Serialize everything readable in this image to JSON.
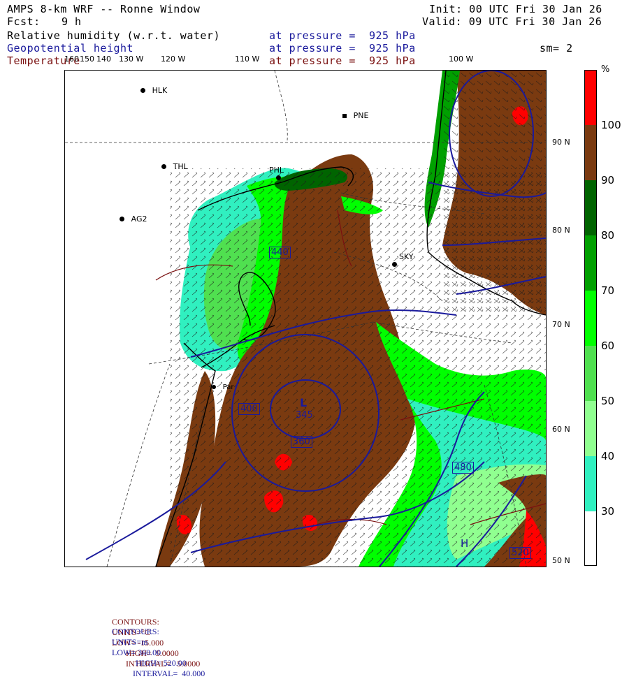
{
  "header": {
    "title": "AMPS 8-km WRF -- Ronne Window",
    "forecast_label": "Fcst:",
    "forecast_value": "9 h",
    "init": "Init: 00 UTC Fri 30 Jan 26",
    "valid": "Valid: 09 UTC Fri 30 Jan 26",
    "fields": [
      {
        "name": "Relative humidity (w.r.t. water)",
        "level": "at pressure =  925 hPa",
        "color": "#000000"
      },
      {
        "name": "Geopotential height",
        "level": "at pressure =  925 hPa",
        "color": "#1a1a9c"
      },
      {
        "name": "Temperature",
        "level": "at pressure =  925 hPa",
        "color": "#7a1010"
      }
    ],
    "smoothing": "sm= 2"
  },
  "colorbar": {
    "unit": "%",
    "levels": [
      "100",
      "90",
      "80",
      "70",
      "60",
      "50",
      "40",
      "30"
    ],
    "bands": [
      {
        "color": "#ff0000"
      },
      {
        "color": "#7a3a10"
      },
      {
        "color": "#006400"
      },
      {
        "color": "#00a000"
      },
      {
        "color": "#00ff00"
      },
      {
        "color": "#50e050"
      },
      {
        "color": "#90ff90"
      },
      {
        "color": "#30f0c0"
      },
      {
        "color": "#ffffff"
      }
    ]
  },
  "longitude_labels": [
    "160",
    "150",
    "140",
    "130 W",
    "120 W",
    "110 W",
    "100 W"
  ],
  "latitude_labels": [
    "90 N",
    "80 N",
    "70 N",
    "60 N",
    "50 N"
  ],
  "stations": [
    {
      "code": "HLK"
    },
    {
      "code": "PNE"
    },
    {
      "code": "THL"
    },
    {
      "code": "PHL"
    },
    {
      "code": "AG2"
    },
    {
      "code": "SKY"
    },
    {
      "code": "Par"
    }
  ],
  "height_contour_labels": [
    "345",
    "360",
    "400",
    "440",
    "480",
    "520"
  ],
  "pressure_centers": [
    {
      "label": "L"
    },
    {
      "label": "H"
    }
  ],
  "footer": {
    "temp": {
      "label": "CONTOURS:",
      "units": "UNITS=°C",
      "low": "LOW= -15.000",
      "high": "HIGH=  5.0000",
      "interval": "INTERVAL=   5.0000"
    },
    "height": {
      "label": "CONTOURS:",
      "units": "UNITS=m",
      "low": "LOW= 360.00",
      "high": "HIGH= 520.00",
      "interval": "INTERVAL=  40.000"
    }
  }
}
